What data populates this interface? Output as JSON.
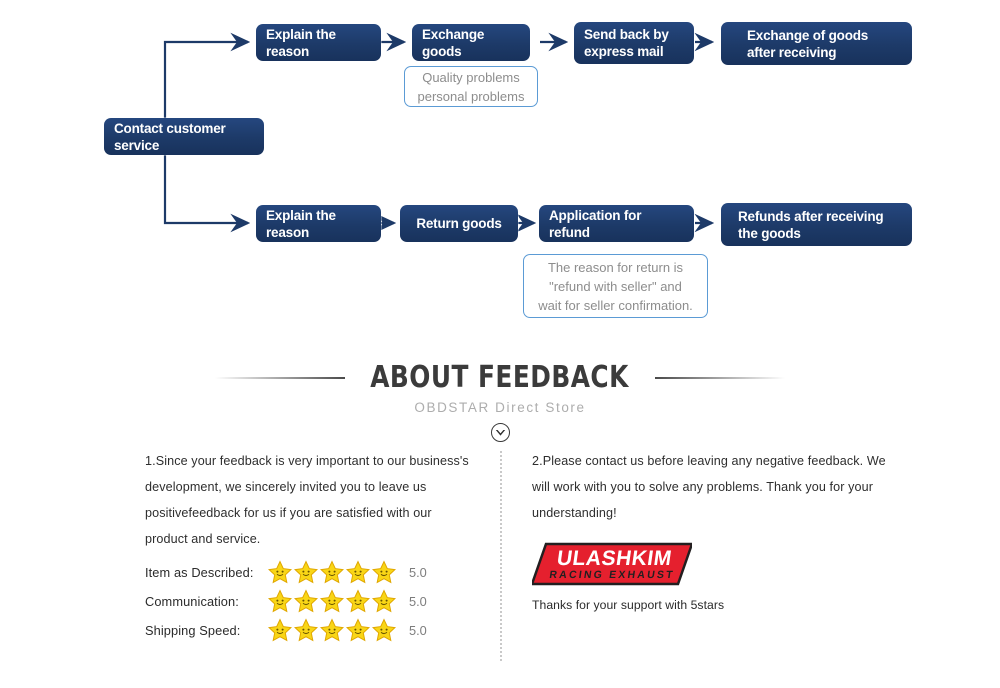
{
  "flowchart": {
    "root": {
      "label": "Contact customer service"
    },
    "branch_exchange": {
      "steps": [
        {
          "label": "Explain the reason"
        },
        {
          "label": "Exchange goods"
        },
        {
          "label": "Send back by\nexpress mail"
        },
        {
          "label": "Exchange of goods\nafter receiving"
        }
      ],
      "callout": {
        "label": "Quality problems\npersonal problems"
      }
    },
    "branch_refund": {
      "steps": [
        {
          "label": "Explain the reason"
        },
        {
          "label": "Return goods"
        },
        {
          "label": "Application for refund"
        },
        {
          "label": "Refunds after receiving\nthe goods"
        }
      ],
      "callout": {
        "label": "The reason for return is\n\"refund with seller\" and\nwait for seller confirmation."
      }
    },
    "colors": {
      "node_fill": "#1d3a68",
      "node_text": "#ffffff",
      "callout_border": "#5b9bd5",
      "callout_text": "#8d8d8d",
      "connector": "#1d3a68"
    }
  },
  "feedback": {
    "title": "ABOUT FEEDBACK",
    "subtitle": "OBDSTAR Direct Store",
    "chevron_icon": "chevron-down-circle-icon",
    "left_paragraph": "1.Since your feedback is very important to our business's development, we sincerely invited you to leave us positivefeedback for us if you are satisfied with our product and service.",
    "right_paragraph": "2.Please contact us before leaving any negative feedback. We will work with you to solve any problems. Thank you for your understanding!",
    "ratings": [
      {
        "label": "Item as Described:",
        "stars": 5,
        "score": "5.0"
      },
      {
        "label": "Communication:",
        "stars": 5,
        "score": "5.0"
      },
      {
        "label": "Shipping Speed:",
        "stars": 5,
        "score": "5.0"
      }
    ],
    "brand": {
      "name": "ULASHKIM",
      "sub": "RACING EXHAUST",
      "tagline": "Thanks for your support with 5stars",
      "logo_color": "#e5202e",
      "logo_outline": "#231f20"
    },
    "star_color": "#f9d616",
    "star_outline": "#e0a700"
  }
}
